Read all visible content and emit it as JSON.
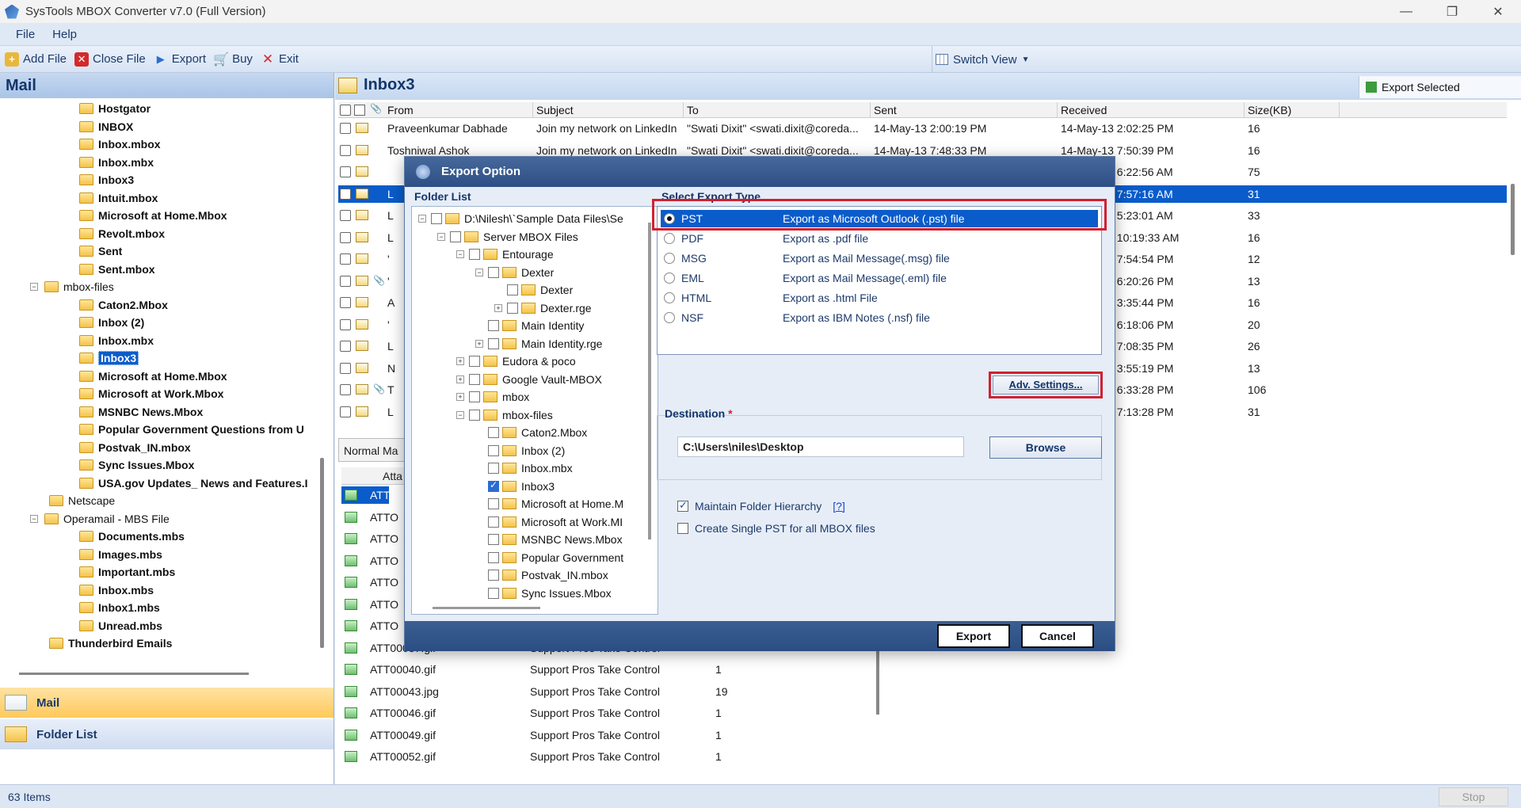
{
  "window": {
    "title": "SysTools MBOX Converter v7.0 (Full Version)",
    "min": "—",
    "max": "❐",
    "close": "✕"
  },
  "menu": {
    "file": "File",
    "help": "Help"
  },
  "toolbar": {
    "add_file": "Add File",
    "close_file": "Close File",
    "export": "Export",
    "buy": "Buy",
    "exit": "Exit",
    "switch_view": "Switch View"
  },
  "left": {
    "header": "Mail",
    "tree": [
      {
        "label": "Hostgator",
        "bold": true
      },
      {
        "label": "INBOX",
        "bold": true
      },
      {
        "label": "Inbox.mbox",
        "bold": true
      },
      {
        "label": "Inbox.mbx",
        "bold": true
      },
      {
        "label": "Inbox3",
        "bold": true
      },
      {
        "label": "Intuit.mbox",
        "bold": true
      },
      {
        "label": "Microsoft at Home.Mbox",
        "bold": true
      },
      {
        "label": "Revolt.mbox",
        "bold": true
      },
      {
        "label": "Sent",
        "bold": true
      },
      {
        "label": "Sent.mbox",
        "bold": true
      },
      {
        "label": "mbox-files",
        "bold": false
      },
      {
        "label": "Caton2.Mbox",
        "bold": true
      },
      {
        "label": "Inbox (2)",
        "bold": true
      },
      {
        "label": "Inbox.mbx",
        "bold": true
      },
      {
        "label": "Inbox3",
        "bold": true
      },
      {
        "label": "Microsoft at Home.Mbox",
        "bold": true
      },
      {
        "label": "Microsoft at Work.Mbox",
        "bold": true
      },
      {
        "label": "MSNBC News.Mbox",
        "bold": true
      },
      {
        "label": "Popular Government Questions from U",
        "bold": true
      },
      {
        "label": "Postvak_IN.mbox",
        "bold": true
      },
      {
        "label": "Sync Issues.Mbox",
        "bold": true
      },
      {
        "label": "USA.gov Updates_ News and Features.I",
        "bold": true
      },
      {
        "label": "Netscape",
        "bold": false
      },
      {
        "label": "Operamail - MBS File",
        "bold": false
      },
      {
        "label": "Documents.mbs",
        "bold": true
      },
      {
        "label": "Images.mbs",
        "bold": true
      },
      {
        "label": "Important.mbs",
        "bold": true
      },
      {
        "label": "Inbox.mbs",
        "bold": true
      },
      {
        "label": "Inbox1.mbs",
        "bold": true
      },
      {
        "label": "Unread.mbs",
        "bold": true
      },
      {
        "label": "Thunderbird Emails",
        "bold": true
      }
    ],
    "nav_mail": "Mail",
    "nav_folder_list": "Folder List"
  },
  "inbox": {
    "title": "Inbox3",
    "export_selected": "Export Selected",
    "columns": [
      "From",
      "Subject",
      "To",
      "Sent",
      "Received",
      "Size(KB)"
    ],
    "rows": [
      {
        "from": "Praveenkumar Dabhade‬",
        "subject": "Join my network on LinkedIn",
        "to": "\"Swati Dixit\" <swati.dixit@coreda...",
        "sent": "14-May-13 2:00:19 PM",
        "received": "14-May-13 2:02:25 PM",
        "size": "16",
        "attach": false
      },
      {
        "from": "Toshniwal Ashok",
        "subject": "Join my network on LinkedIn",
        "to": "\"Swati Dixit\" <swati.dixit@coreda...",
        "sent": "14-May-13 7:48:33 PM",
        "received": "14-May-13 7:50:39 PM",
        "size": "16",
        "attach": false
      },
      {
        "from": "",
        "subject": "",
        "to": "",
        "sent": "",
        "received": "16-May-13 6:22:56 AM",
        "size": "75",
        "attach": false
      },
      {
        "from": "L",
        "subject": "",
        "to": "",
        "sent": "",
        "received": "16-May-13 7:57:16 AM",
        "size": "31",
        "attach": false,
        "selected": true
      },
      {
        "from": "L",
        "subject": "",
        "to": "",
        "sent": "",
        "received": "17-May-13 5:23:01 AM",
        "size": "33",
        "attach": false
      },
      {
        "from": "L",
        "subject": "",
        "to": "",
        "sent": "",
        "received": "17-May-13 10:19:33 AM",
        "size": "16",
        "attach": false
      },
      {
        "from": "'",
        "subject": "",
        "to": "",
        "sent": "",
        "received": "17-May-13 7:54:54 PM",
        "size": "12",
        "attach": false
      },
      {
        "from": "'",
        "subject": "",
        "to": "",
        "sent": "",
        "received": "18-May-13 6:20:26 PM",
        "size": "13",
        "attach": true
      },
      {
        "from": "A",
        "subject": "",
        "to": "",
        "sent": "",
        "received": "19-May-13 3:35:44 PM",
        "size": "16",
        "attach": false
      },
      {
        "from": "'",
        "subject": "",
        "to": "",
        "sent": "",
        "received": "20-May-13 6:18:06 PM",
        "size": "20",
        "attach": false
      },
      {
        "from": "L",
        "subject": "",
        "to": "",
        "sent": "",
        "received": "21-May-13 7:08:35 PM",
        "size": "26",
        "attach": false
      },
      {
        "from": "N",
        "subject": "",
        "to": "",
        "sent": "",
        "received": "22-May-13 3:55:19 PM",
        "size": "13",
        "attach": false
      },
      {
        "from": "T",
        "subject": "",
        "to": "",
        "sent": "",
        "received": "22-May-13 6:33:28 PM",
        "size": "106",
        "attach": true
      },
      {
        "from": "L",
        "subject": "",
        "to": "",
        "sent": "",
        "received": "22-May-13 7:13:28 PM",
        "size": "31",
        "attach": false
      }
    ],
    "preview_tab": "Normal Ma",
    "att_col": "Atta",
    "attachments": [
      {
        "name": "ATTO",
        "subject": "",
        "size": "",
        "selected": true
      },
      {
        "name": "ATTO",
        "subject": "",
        "size": ""
      },
      {
        "name": "ATTO",
        "subject": "",
        "size": ""
      },
      {
        "name": "ATTO",
        "subject": "",
        "size": ""
      },
      {
        "name": "ATTO",
        "subject": "",
        "size": ""
      },
      {
        "name": "ATTO",
        "subject": "",
        "size": ""
      },
      {
        "name": "ATTO",
        "subject": "",
        "size": ""
      },
      {
        "name": "ATT00037.gif",
        "subject": "Support Pros Take Control",
        "size": ""
      },
      {
        "name": "ATT00040.gif",
        "subject": "Support Pros Take Control",
        "size": "1"
      },
      {
        "name": "ATT00043.jpg",
        "subject": "Support Pros Take Control",
        "size": "19"
      },
      {
        "name": "ATT00046.gif",
        "subject": "Support Pros Take Control",
        "size": "1"
      },
      {
        "name": "ATT00049.gif",
        "subject": "Support Pros Take Control",
        "size": "1"
      },
      {
        "name": "ATT00052.gif",
        "subject": "Support Pros Take Control",
        "size": "1"
      }
    ]
  },
  "status": {
    "items": "63 Items",
    "stop": "Stop"
  },
  "dialog": {
    "title": "Export Option",
    "folder_list_label": "Folder List",
    "folder_tree": [
      {
        "label": "D:\\Nilesh\\`Sample Data Files\\Se",
        "indent": 0,
        "exp": "−",
        "check": false,
        "folder": true
      },
      {
        "label": "Server MBOX Files",
        "indent": 1,
        "exp": "−",
        "check": false,
        "folder": true
      },
      {
        "label": "Entourage",
        "indent": 2,
        "exp": "−",
        "check": false,
        "folder": true
      },
      {
        "label": "Dexter",
        "indent": 3,
        "exp": "−",
        "check": false,
        "folder": true
      },
      {
        "label": "Dexter",
        "indent": 4,
        "exp": "",
        "check": false,
        "folder": true
      },
      {
        "label": "Dexter.rge",
        "indent": 4,
        "exp": "+",
        "check": false,
        "folder": true
      },
      {
        "label": "Main Identity",
        "indent": 3,
        "exp": "",
        "check": false,
        "folder": true
      },
      {
        "label": "Main Identity.rge",
        "indent": 3,
        "exp": "+",
        "check": false,
        "folder": true
      },
      {
        "label": "Eudora & poco",
        "indent": 2,
        "exp": "+",
        "check": false,
        "folder": true
      },
      {
        "label": "Google Vault-MBOX",
        "indent": 2,
        "exp": "+",
        "check": false,
        "folder": true
      },
      {
        "label": "mbox",
        "indent": 2,
        "exp": "+",
        "check": false,
        "folder": true
      },
      {
        "label": "mbox-files",
        "indent": 2,
        "exp": "−",
        "check": false,
        "folder": true
      },
      {
        "label": "Caton2.Mbox",
        "indent": 3,
        "exp": "",
        "check": false,
        "folder": true
      },
      {
        "label": "Inbox (2)",
        "indent": 3,
        "exp": "",
        "check": false,
        "folder": true
      },
      {
        "label": "Inbox.mbx",
        "indent": 3,
        "exp": "",
        "check": false,
        "folder": true
      },
      {
        "label": "Inbox3",
        "indent": 3,
        "exp": "",
        "check": true,
        "folder": true
      },
      {
        "label": "Microsoft at Home.M",
        "indent": 3,
        "exp": "",
        "check": false,
        "folder": true
      },
      {
        "label": "Microsoft at Work.MI",
        "indent": 3,
        "exp": "",
        "check": false,
        "folder": true
      },
      {
        "label": "MSNBC News.Mbox",
        "indent": 3,
        "exp": "",
        "check": false,
        "folder": true
      },
      {
        "label": "Popular Government",
        "indent": 3,
        "exp": "",
        "check": false,
        "folder": true
      },
      {
        "label": "Postvak_IN.mbox",
        "indent": 3,
        "exp": "",
        "check": false,
        "folder": true
      },
      {
        "label": "Sync Issues.Mbox",
        "indent": 3,
        "exp": "",
        "check": false,
        "folder": true
      }
    ],
    "select_type_label": "Select Export Type",
    "types": [
      {
        "name": "PST",
        "desc": "Export as Microsoft Outlook (.pst) file",
        "selected": true
      },
      {
        "name": "PDF",
        "desc": "Export as .pdf file"
      },
      {
        "name": "MSG",
        "desc": "Export as Mail Message(.msg) file"
      },
      {
        "name": "EML",
        "desc": "Export as Mail Message(.eml) file"
      },
      {
        "name": "HTML",
        "desc": "Export as .html File"
      },
      {
        "name": "NSF",
        "desc": "Export as IBM Notes (.nsf) file"
      }
    ],
    "adv_settings": "Adv. Settings...",
    "destination_label": "Destination",
    "destination_required": "*",
    "destination_value": "C:\\Users\\niles\\Desktop",
    "browse": "Browse",
    "maintain_hierarchy": "Maintain Folder Hierarchy",
    "maintain_hierarchy_checked": true,
    "help_link": "[?]",
    "single_pst": "Create Single PST for all MBOX files",
    "single_pst_checked": false,
    "export_btn": "Export",
    "cancel_btn": "Cancel"
  },
  "colors": {
    "selection": "#0a5ccb",
    "highlight_red": "#d2202f",
    "dialog_header": "#2d4f85"
  }
}
